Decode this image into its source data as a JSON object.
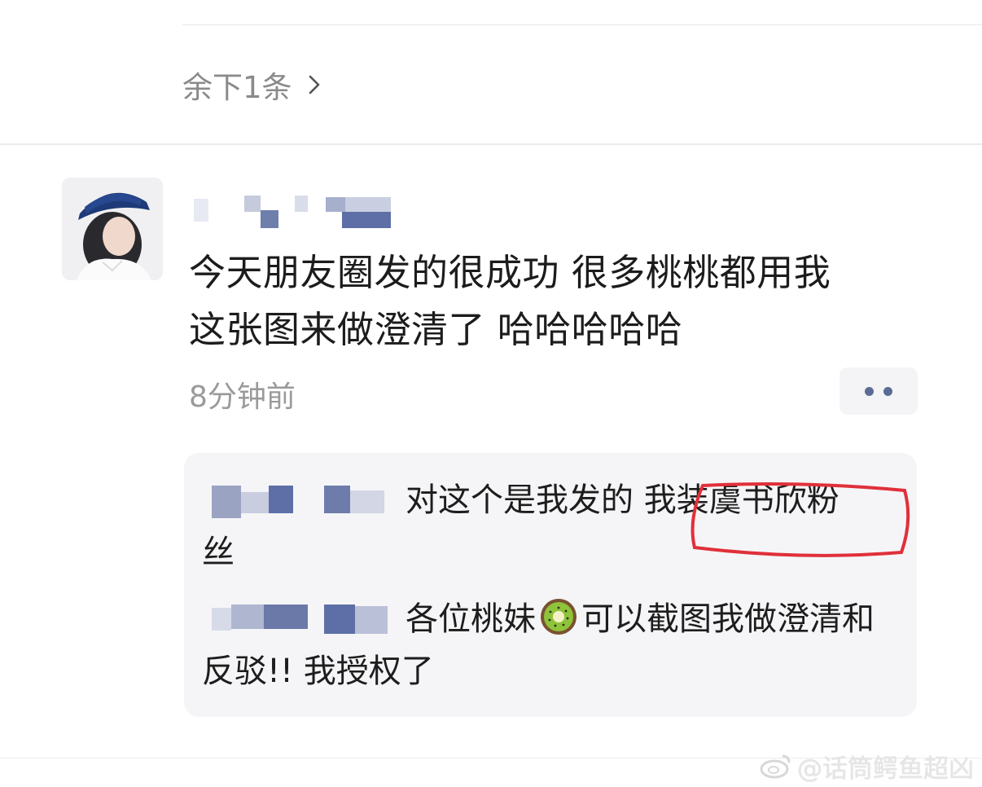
{
  "thread": {
    "more_replies_label": "余下1条"
  },
  "post": {
    "text_line1": "今天朋友圈发的很成功 很多桃桃都用我",
    "text_line2": "这张图来做澄清了 哈哈哈哈哈",
    "time": "8分钟前"
  },
  "comments": [
    {
      "text_before": "对这个是我发的 ",
      "highlighted": "我装虞书欣粉",
      "text_after": "丝"
    },
    {
      "text_before": "各位桃妹",
      "emoji": "kiwi-icon",
      "text_after": "可以截图我做澄清和反驳!! 我授权了"
    }
  ],
  "watermark": {
    "text": "@话筒鳄鱼超凶"
  },
  "colors": {
    "highlight_circle": "#e0303a",
    "more_dots": "#5a6c96",
    "blur_blue": "#5d6fa6"
  }
}
